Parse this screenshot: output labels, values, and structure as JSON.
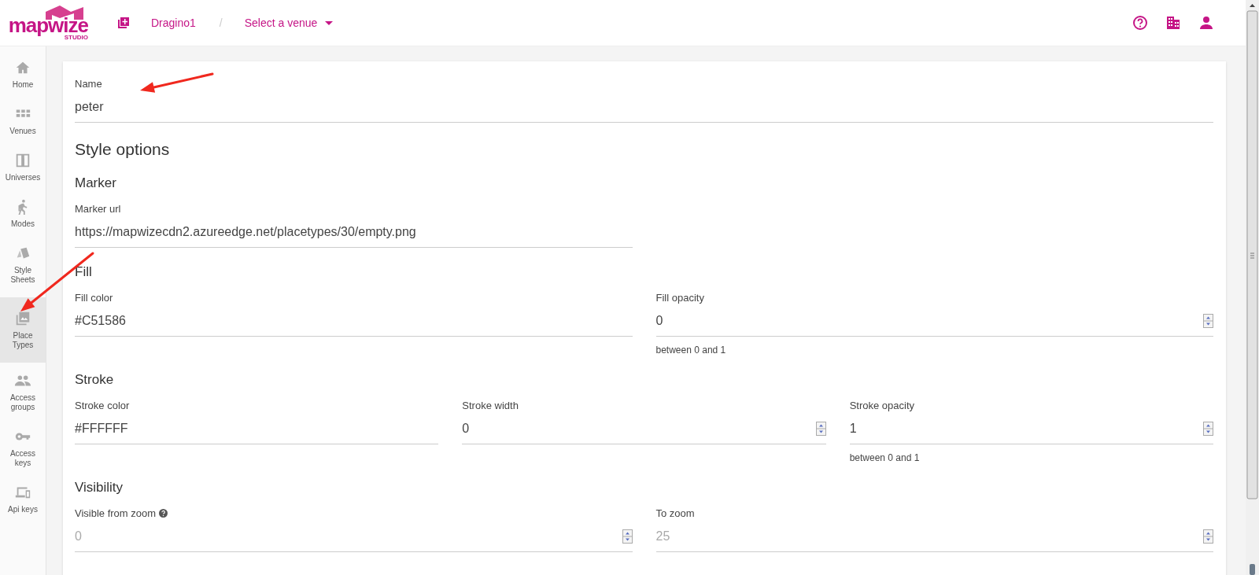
{
  "header": {
    "logo": {
      "wordmark": "mapwize",
      "subtitle": "STUDIO"
    },
    "project": "Dragino1",
    "separator": "/",
    "venue_select": "Select a venue"
  },
  "sidebar": {
    "items": [
      {
        "label": "Home",
        "selected": false
      },
      {
        "label": "Venues",
        "selected": false
      },
      {
        "label": "Universes",
        "selected": false
      },
      {
        "label": "Modes",
        "selected": false
      },
      {
        "label": "Style Sheets",
        "selected": false
      },
      {
        "label": "Place Types",
        "selected": true
      },
      {
        "label": "Access groups",
        "selected": false
      },
      {
        "label": "Access keys",
        "selected": false
      },
      {
        "label": "Api keys",
        "selected": false
      }
    ]
  },
  "form": {
    "name_field": {
      "label": "Name",
      "value": "peter"
    },
    "title": "Style options",
    "sections": [
      {
        "heading": "Marker",
        "fields": [
          {
            "label": "Marker url",
            "value": "https://mapwizecdn2.azureedge.net/placetypes/30/empty.png",
            "kind": "text",
            "disabled": false
          }
        ]
      },
      {
        "heading": "Fill",
        "fields": [
          {
            "label": "Fill color",
            "value": "#C51586",
            "kind": "text",
            "disabled": false
          },
          {
            "label": "Fill opacity",
            "value": "0",
            "kind": "number",
            "disabled": false,
            "helper": "between 0 and 1"
          }
        ]
      },
      {
        "heading": "Stroke",
        "fields": [
          {
            "label": "Stroke color",
            "value": "#FFFFFF",
            "kind": "text",
            "disabled": false
          },
          {
            "label": "Stroke width",
            "value": "0",
            "kind": "number",
            "disabled": false
          },
          {
            "label": "Stroke opacity",
            "value": "1",
            "kind": "number",
            "disabled": false,
            "helper": "between 0 and 1"
          }
        ]
      },
      {
        "heading": "Visibility",
        "fields": [
          {
            "label": "Visible from zoom",
            "value": "0",
            "kind": "number",
            "disabled": true,
            "help_icon": true
          },
          {
            "label": "To zoom",
            "value": "25",
            "kind": "number",
            "disabled": true
          }
        ]
      }
    ]
  },
  "annotations": [
    {
      "kind": "arrow"
    },
    {
      "kind": "arrow"
    }
  ]
}
